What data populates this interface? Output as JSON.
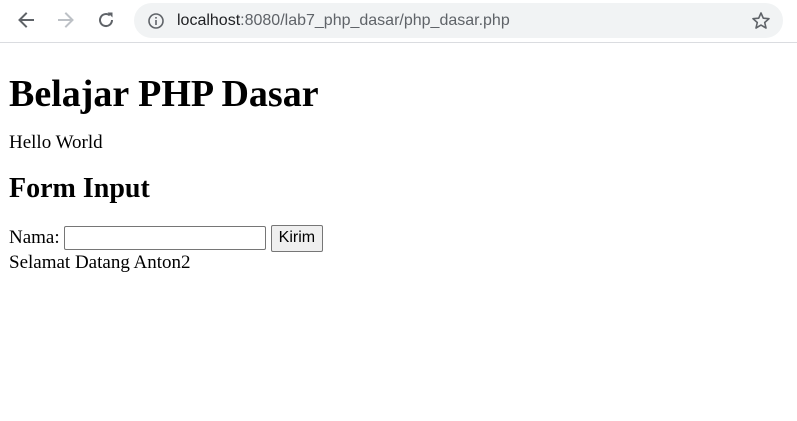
{
  "browser": {
    "url_host": "localhost",
    "url_path": ":8080/lab7_php_dasar/php_dasar.php"
  },
  "page": {
    "title": "Belajar PHP Dasar",
    "hello": "Hello World",
    "form_heading": "Form Input",
    "name_label": "Nama:",
    "name_value": "",
    "submit_label": "Kirim",
    "greeting": "Selamat Datang Anton2"
  },
  "icons": {
    "back": "arrow-left-icon",
    "forward": "arrow-right-icon",
    "reload": "reload-icon",
    "info": "info-icon",
    "bookmark": "star-icon"
  },
  "colors": {
    "omnibox_bg": "#f1f3f4",
    "icon_active": "#5f6368",
    "icon_disabled": "#bdc1c6"
  }
}
